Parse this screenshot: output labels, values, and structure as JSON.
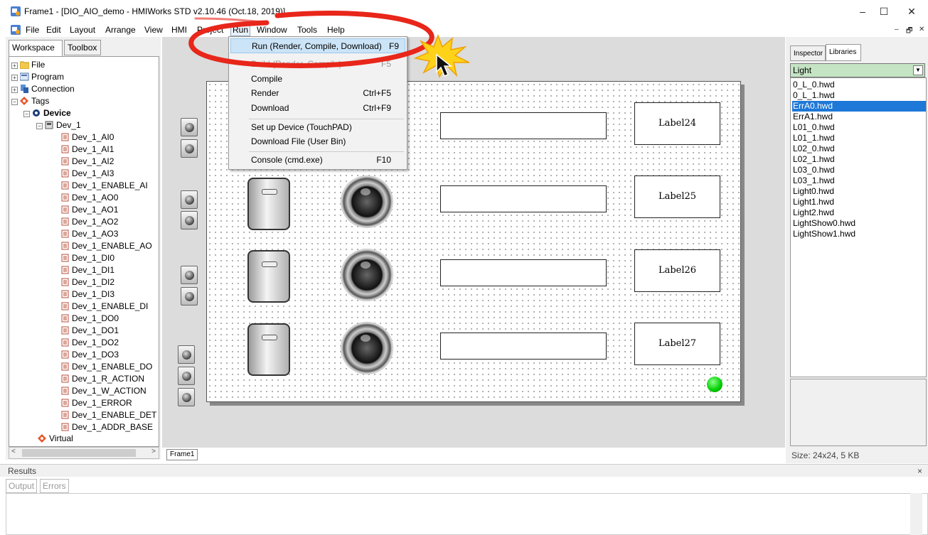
{
  "window": {
    "title": "Frame1 - [DIO_AIO_demo - HMIWorks STD v2.10.46 (Oct.18, 2019)]",
    "minimize_glyph": "–",
    "maximize_glyph": "☐",
    "close_glyph": "✕"
  },
  "menubar": {
    "items": [
      "File",
      "Edit",
      "Layout",
      "Arrange",
      "View",
      "HMI",
      "Project",
      "Run",
      "Window",
      "Tools",
      "Help"
    ],
    "active": "Run",
    "mdi_min": "–",
    "mdi_restore": "🗗",
    "mdi_close": "✕"
  },
  "left_tabs": [
    "Workspace",
    "Toolbox"
  ],
  "tree": {
    "file": "File",
    "program": "Program",
    "connection": "Connection",
    "tags": "Tags",
    "device": "Device",
    "dev1": "Dev_1",
    "tags_list": [
      "Dev_1_AI0",
      "Dev_1_AI1",
      "Dev_1_AI2",
      "Dev_1_AI3",
      "Dev_1_ENABLE_AI",
      "Dev_1_AO0",
      "Dev_1_AO1",
      "Dev_1_AO2",
      "Dev_1_AO3",
      "Dev_1_ENABLE_AO",
      "Dev_1_DI0",
      "Dev_1_DI1",
      "Dev_1_DI2",
      "Dev_1_DI3",
      "Dev_1_ENABLE_DI",
      "Dev_1_DO0",
      "Dev_1_DO1",
      "Dev_1_DO2",
      "Dev_1_DO3",
      "Dev_1_ENABLE_DO",
      "Dev_1_R_ACTION",
      "Dev_1_W_ACTION",
      "Dev_1_ERROR",
      "Dev_1_ENABLE_DET",
      "Dev_1_ADDR_BASE"
    ],
    "virtual": "Virtual"
  },
  "run_menu": {
    "items": [
      {
        "label": "Run (Render, Compile, Download)",
        "shortcut": "F9",
        "highlighted": true
      },
      {
        "label": "Build (Render, Compile)",
        "shortcut": "F5",
        "highlighted": false
      },
      {
        "label": "Compile",
        "shortcut": "",
        "highlighted": false
      },
      {
        "label": "Render",
        "shortcut": "Ctrl+F5",
        "highlighted": false
      },
      {
        "label": "Download",
        "shortcut": "Ctrl+F9",
        "highlighted": false
      },
      {
        "label": "Set up Device (TouchPAD)",
        "shortcut": "",
        "highlighted": false
      },
      {
        "label": "Download File (User Bin)",
        "shortcut": "",
        "highlighted": false
      },
      {
        "label": "Console (cmd.exe)",
        "shortcut": "F10",
        "highlighted": false
      }
    ]
  },
  "canvas": {
    "labels": [
      "Label24",
      "Label25",
      "Label26",
      "Label27"
    ],
    "frame_tab": "Frame1"
  },
  "right_tabs": [
    "Inspector",
    "Libraries"
  ],
  "library": {
    "category": "Light",
    "files": [
      "0_L_0.hwd",
      "0_L_1.hwd",
      "ErrA0.hwd",
      "ErrA1.hwd",
      "L01_0.hwd",
      "L01_1.hwd",
      "L02_0.hwd",
      "L02_1.hwd",
      "L03_0.hwd",
      "L03_1.hwd",
      "Light0.hwd",
      "Light1.hwd",
      "Light2.hwd",
      "LightShow0.hwd",
      "LightShow1.hwd"
    ],
    "selected": "ErrA0.hwd",
    "size_info": "Size: 24x24, 5 KB"
  },
  "results": {
    "title": "Results",
    "tabs": [
      "Output",
      "Errors"
    ],
    "close_glyph": "×"
  },
  "colors": {
    "annotation_red": "#e8261a",
    "burst_yellow": "#ffd21a",
    "menu_highlight": "#cce4f7",
    "list_selection": "#1e78d7",
    "combo_green": "#c4e4c4"
  }
}
